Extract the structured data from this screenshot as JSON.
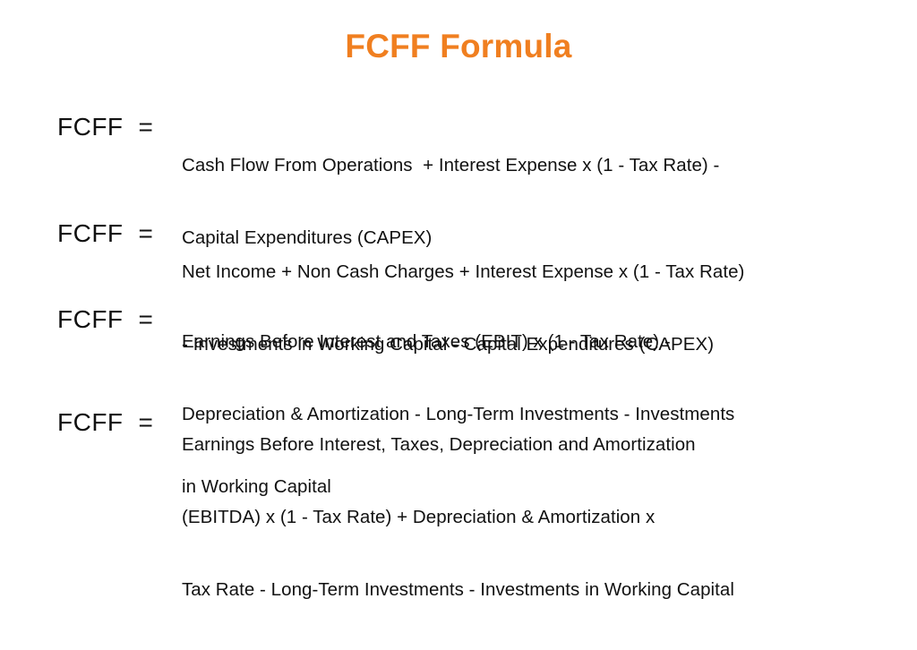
{
  "title": "FCFF Formula",
  "accent_color": "#f07f20",
  "text_color": "#111111",
  "background_color": "#ffffff",
  "formulas": [
    {
      "label": "FCFF",
      "equals": "=",
      "lines": [
        "Cash Flow From Operations  + Interest Expense x (1 - Tax Rate) -",
        "Capital Expenditures (CAPEX)"
      ]
    },
    {
      "label": "FCFF",
      "equals": "=",
      "lines": [
        "Net Income + Non Cash Charges + Interest Expense x (1 - Tax Rate)",
        "- Investments in Working Capital - Capital Expenditures (CAPEX)"
      ]
    },
    {
      "label": "FCFF",
      "equals": "=",
      "lines": [
        "Earnings Before Interest and Taxes (EBIT) x (1 - Tax Rate) -",
        "Depreciation & Amortization - Long-Term Investments - Investments",
        "in Working Capital"
      ]
    },
    {
      "label": "FCFF",
      "equals": "=",
      "lines": [
        "Earnings Before Interest, Taxes, Depreciation and Amortization",
        "(EBITDA) x (1 - Tax Rate) + Depreciation & Amortization x",
        "Tax Rate - Long-Term Investments - Investments in Working Capital"
      ]
    }
  ]
}
